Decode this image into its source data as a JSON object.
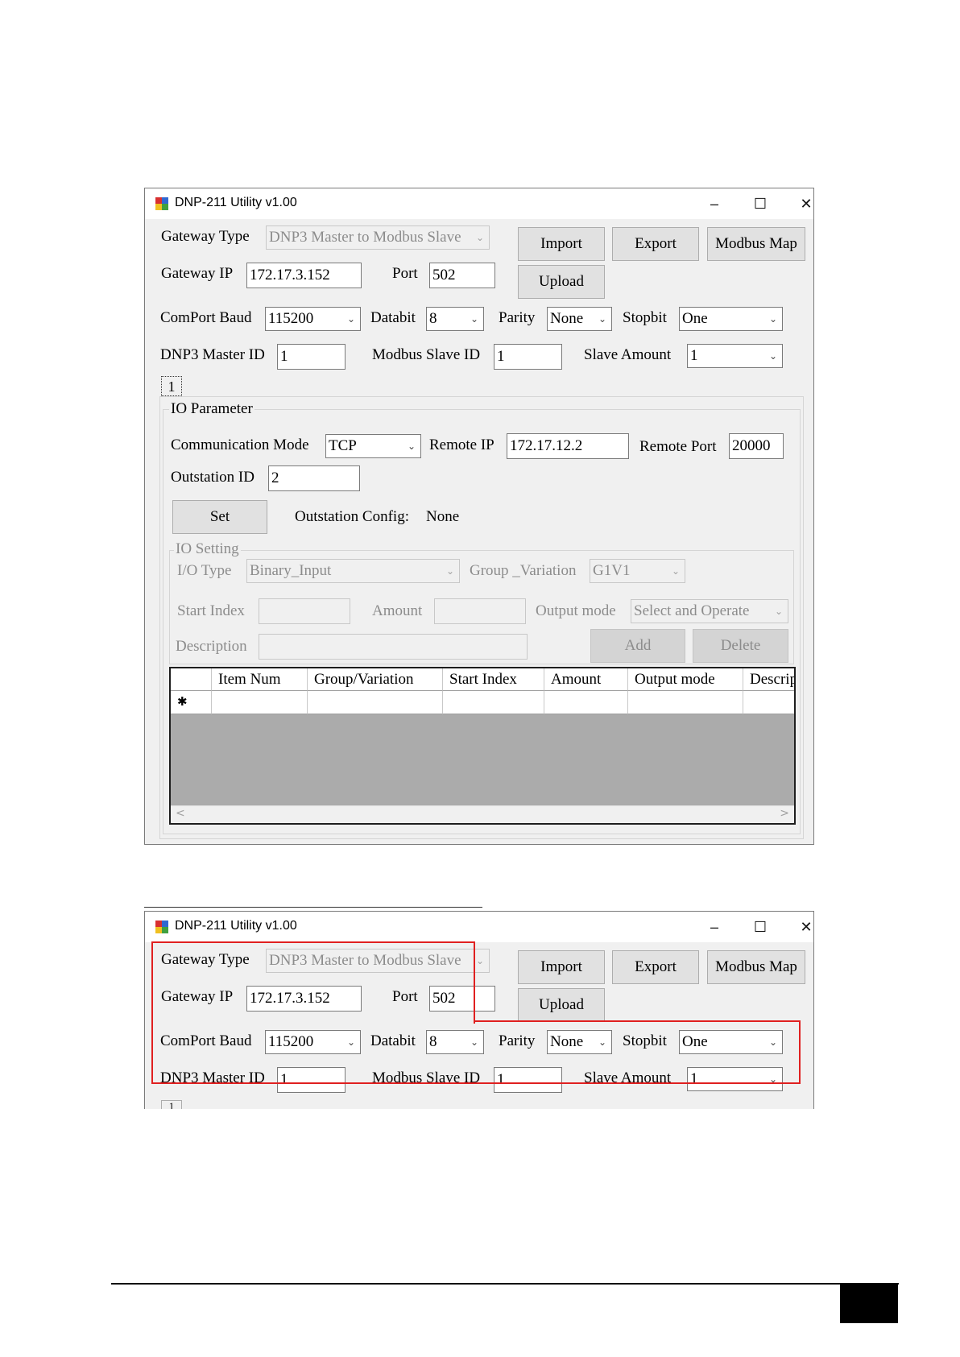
{
  "window_title": "DNP-211 Utility v1.00",
  "title_buttons": {
    "minimize": "–",
    "maximize": "☐",
    "close": "✕"
  },
  "gateway": {
    "type_label": "Gateway Type",
    "type_value": "DNP3 Master to Modbus Slave",
    "ip_label": "Gateway IP",
    "ip_value": "172.17.3.152",
    "port_label": "Port",
    "port_value": "502"
  },
  "buttons": {
    "import": "Import",
    "export": "Export",
    "modbus_map": "Modbus Map",
    "upload": "Upload",
    "set": "Set",
    "add": "Add",
    "delete": "Delete"
  },
  "serial": {
    "baud_label": "ComPort Baud",
    "baud_value": "115200",
    "databit_label": "Databit",
    "databit_value": "8",
    "parity_label": "Parity",
    "parity_value": "None",
    "stopbit_label": "Stopbit",
    "stopbit_value": "One"
  },
  "ids": {
    "master_label": "DNP3 Master ID",
    "master_value": "1",
    "slave_label": "Modbus Slave ID",
    "slave_value": "1",
    "amount_label": "Slave Amount",
    "amount_value": "1"
  },
  "tab_label": "1",
  "io_param": {
    "title": "IO Parameter",
    "comm_mode_label": "Communication Mode",
    "comm_mode_value": "TCP",
    "remote_ip_label": "Remote IP",
    "remote_ip_value": "172.17.12.2",
    "remote_port_label": "Remote Port",
    "remote_port_value": "20000",
    "outstation_id_label": "Outstation ID",
    "outstation_id_value": "2",
    "outstation_config_label": "Outstation Config:",
    "outstation_config_value": "None"
  },
  "io_setting": {
    "title": "IO Setting",
    "io_type_label": "I/O Type",
    "io_type_value": "Binary_Input",
    "group_var_label": "Group _Variation",
    "group_var_value": "G1V1",
    "start_index_label": "Start Index",
    "amount_label": "Amount",
    "output_mode_label": "Output mode",
    "output_mode_value": "Select and Operate",
    "description_label": "Description"
  },
  "grid": {
    "columns": [
      "Item Num",
      "Group/Variation",
      "Start Index",
      "Amount",
      "Output mode",
      "Descrip"
    ],
    "new_row_marker": "✱"
  },
  "scroll": {
    "left": "<",
    "right": ">"
  },
  "colors": {
    "highlight": "#e02020",
    "window_bg": "#f0f0f0",
    "grid_bg": "#ababab"
  }
}
